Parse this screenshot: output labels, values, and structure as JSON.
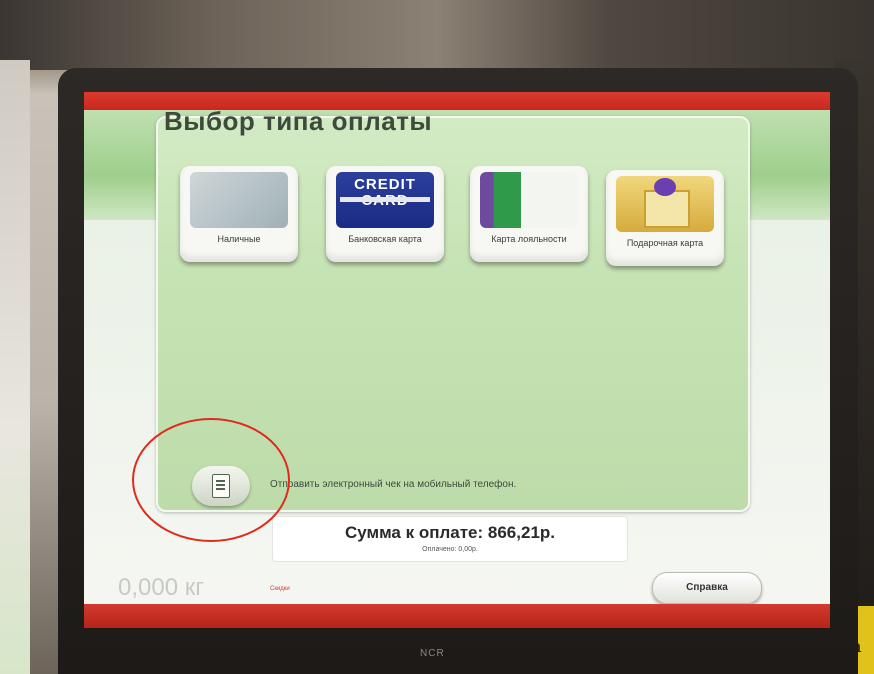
{
  "screen": {
    "title": "Выбор типа оплаты",
    "payment_options": [
      {
        "label": "Наличные",
        "icon": "cash-icon"
      },
      {
        "label": "Банковская карта",
        "icon": "credit-card-icon",
        "card_text": "CREDIT CARD"
      },
      {
        "label": "Карта лояльности",
        "icon": "loyalty-card-icon"
      },
      {
        "label": "Подарочная карта",
        "icon": "gift-card-icon"
      }
    ],
    "receipt": {
      "label": "Отправить электронный чек на мобильный телефон.",
      "icon": "receipt-icon"
    },
    "total": {
      "label": "Сумма к оплате: 866,21р.",
      "paid": "Оплачено: 0,00р."
    },
    "weight": "0,000 кг",
    "small_status": "Скидки",
    "help_button": "Справка"
  },
  "hardware": {
    "brand": "NCR",
    "sign_text": "ажа"
  },
  "colors": {
    "accent_red": "#c9281f",
    "panel_green": "#c6e3b4",
    "annotation_red": "#e02a1e"
  }
}
